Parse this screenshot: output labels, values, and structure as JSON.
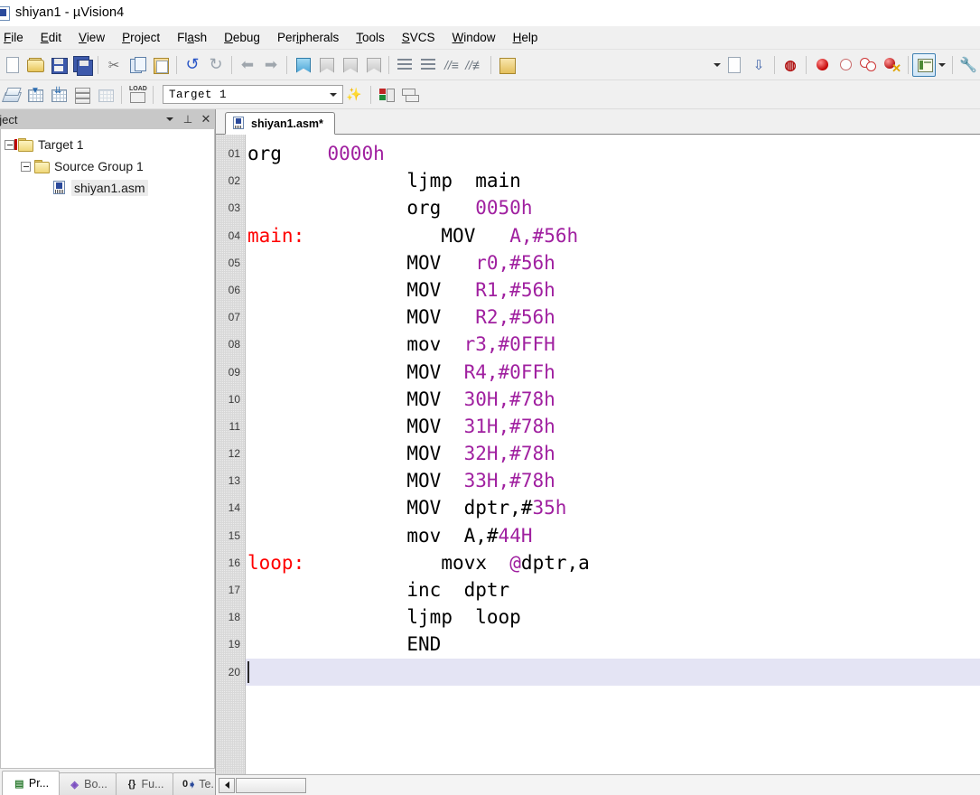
{
  "window": {
    "title": "shiyan1  - µVision4",
    "app_icon": "uvision-icon"
  },
  "menubar": {
    "items": [
      {
        "label": "File",
        "accel": "F"
      },
      {
        "label": "Edit",
        "accel": "E"
      },
      {
        "label": "View",
        "accel": "V"
      },
      {
        "label": "Project",
        "accel": "P"
      },
      {
        "label": "Flash",
        "accel": "a"
      },
      {
        "label": "Debug",
        "accel": "D"
      },
      {
        "label": "Peripherals",
        "accel": "i"
      },
      {
        "label": "Tools",
        "accel": "T"
      },
      {
        "label": "SVCS",
        "accel": "S"
      },
      {
        "label": "Window",
        "accel": "W"
      },
      {
        "label": "Help",
        "accel": "H"
      }
    ]
  },
  "toolbar_main": {
    "buttons": [
      {
        "name": "new-file-icon",
        "tooltip": "New"
      },
      {
        "name": "open-file-icon",
        "tooltip": "Open"
      },
      {
        "name": "save-icon",
        "tooltip": "Save"
      },
      {
        "name": "save-all-icon",
        "tooltip": "Save All"
      },
      {
        "name": "cut-icon",
        "tooltip": "Cut"
      },
      {
        "name": "copy-icon",
        "tooltip": "Copy"
      },
      {
        "name": "paste-icon",
        "tooltip": "Paste"
      },
      {
        "name": "undo-icon",
        "tooltip": "Undo"
      },
      {
        "name": "redo-icon",
        "tooltip": "Redo"
      },
      {
        "name": "navigate-back-icon",
        "tooltip": "Back"
      },
      {
        "name": "navigate-forward-icon",
        "tooltip": "Forward"
      },
      {
        "name": "toggle-bookmark-icon",
        "tooltip": "Insert/Remove Bookmark"
      },
      {
        "name": "prev-bookmark-icon",
        "tooltip": "Previous Bookmark"
      },
      {
        "name": "next-bookmark-icon",
        "tooltip": "Next Bookmark"
      },
      {
        "name": "clear-bookmarks-icon",
        "tooltip": "Clear All Bookmarks"
      },
      {
        "name": "indent-icon",
        "tooltip": "Indent Selection"
      },
      {
        "name": "outdent-icon",
        "tooltip": "Outdent Selection"
      },
      {
        "name": "comment-icon",
        "tooltip": "Comment Selection"
      },
      {
        "name": "uncomment-icon",
        "tooltip": "Uncomment Selection"
      },
      {
        "name": "find-in-files-icon",
        "tooltip": "Find in Files"
      },
      {
        "name": "find-combo-arrow-icon",
        "tooltip": "Find"
      },
      {
        "name": "goto-definition-icon",
        "tooltip": "Go To Definition"
      },
      {
        "name": "find-next-icon",
        "tooltip": "Find Next"
      },
      {
        "name": "debug-search-icon",
        "tooltip": "Find"
      },
      {
        "name": "insert-breakpoint-icon",
        "tooltip": "Insert/Remove Breakpoint"
      },
      {
        "name": "disable-breakpoint-icon",
        "tooltip": "Enable/Disable Breakpoint"
      },
      {
        "name": "disable-all-breakpoints-icon",
        "tooltip": "Disable All Breakpoints"
      },
      {
        "name": "kill-all-breakpoints-icon",
        "tooltip": "Kill All Breakpoints"
      },
      {
        "name": "project-window-icon",
        "tooltip": "Project Window",
        "active": true
      },
      {
        "name": "project-window-dropdown-icon",
        "tooltip": "More Windows"
      },
      {
        "name": "configure-icon",
        "tooltip": "Configuration Wizard"
      }
    ]
  },
  "toolbar_build": {
    "buttons": [
      {
        "name": "translate-icon",
        "tooltip": "Translate"
      },
      {
        "name": "build-target-icon",
        "tooltip": "Build Target"
      },
      {
        "name": "rebuild-all-icon",
        "tooltip": "Rebuild All Target Files"
      },
      {
        "name": "batch-build-icon",
        "tooltip": "Batch Build"
      },
      {
        "name": "stop-build-icon",
        "tooltip": "Stop Build"
      },
      {
        "name": "download-icon",
        "tooltip": "Download to Flash"
      },
      {
        "name": "target-options-icon",
        "tooltip": "Options for Target"
      },
      {
        "name": "manage-components-icon",
        "tooltip": "Manage Components"
      },
      {
        "name": "multi-project-icon",
        "tooltip": "Manage Multi-Project"
      }
    ],
    "target_select": {
      "value": "Target 1",
      "options": [
        "Target 1"
      ]
    }
  },
  "project_panel": {
    "title": "oject",
    "controls": [
      {
        "name": "panel-menu-icon",
        "glyph": "▼"
      },
      {
        "name": "panel-pin-icon",
        "glyph": "⊥"
      },
      {
        "name": "panel-close-icon",
        "glyph": "✕"
      }
    ],
    "tree": [
      {
        "label": "Target 1",
        "level": 1,
        "icon": "target-folder-icon",
        "expanded": true,
        "selected": false
      },
      {
        "label": "Source Group 1",
        "level": 2,
        "icon": "folder-icon",
        "expanded": true,
        "selected": false
      },
      {
        "label": "shiyan1.asm",
        "level": 3,
        "icon": "asm-file-icon",
        "expanded": false,
        "selected": true
      }
    ],
    "tabs": [
      {
        "label": "Pr...",
        "icon": "project-tab-icon",
        "active": true
      },
      {
        "label": "Bo...",
        "icon": "books-tab-icon",
        "active": false
      },
      {
        "label": "Fu...",
        "icon": "functions-tab-icon",
        "active": false
      },
      {
        "label": "Te...",
        "icon": "templates-tab-icon",
        "active": false
      }
    ]
  },
  "editor": {
    "tabs": [
      {
        "label": "shiyan1.asm*",
        "icon": "asm-file-icon",
        "active": true,
        "modified": true
      }
    ],
    "current_line": 20,
    "scrollbar": {
      "name": "horizontal-scrollbar",
      "position": "left"
    },
    "lines": [
      {
        "num": "01",
        "tokens": [
          {
            "t": "org    ",
            "c": "plain"
          },
          {
            "t": "0000h",
            "c": "num"
          }
        ],
        "indent": 0
      },
      {
        "num": "02",
        "tokens": [
          {
            "t": "ljmp  main",
            "c": "plain"
          }
        ],
        "indent": 14
      },
      {
        "num": "03",
        "tokens": [
          {
            "t": "org   ",
            "c": "plain"
          },
          {
            "t": "0050h",
            "c": "num"
          }
        ],
        "indent": 14
      },
      {
        "num": "04",
        "tokens": [
          {
            "t": "main:",
            "c": "label"
          }
        ],
        "indent": 0,
        "extra": {
          "indent": 14,
          "tokens": [
            {
              "t": "MOV   ",
              "c": "plain"
            },
            {
              "t": "A,#56h",
              "c": "num"
            }
          ]
        }
      },
      {
        "num": "05",
        "tokens": [
          {
            "t": "MOV   ",
            "c": "plain"
          },
          {
            "t": "r0,#56h",
            "c": "num"
          }
        ],
        "indent": 14
      },
      {
        "num": "06",
        "tokens": [
          {
            "t": "MOV   ",
            "c": "plain"
          },
          {
            "t": "R1,#56h",
            "c": "num"
          }
        ],
        "indent": 14
      },
      {
        "num": "07",
        "tokens": [
          {
            "t": "MOV   ",
            "c": "plain"
          },
          {
            "t": "R2,#56h",
            "c": "num"
          }
        ],
        "indent": 14
      },
      {
        "num": "08",
        "tokens": [
          {
            "t": "mov  ",
            "c": "plain"
          },
          {
            "t": "r3,#0FFH",
            "c": "num"
          }
        ],
        "indent": 14
      },
      {
        "num": "09",
        "tokens": [
          {
            "t": "MOV  ",
            "c": "plain"
          },
          {
            "t": "R4,#0FFh",
            "c": "num"
          }
        ],
        "indent": 14
      },
      {
        "num": "10",
        "tokens": [
          {
            "t": "MOV  ",
            "c": "plain"
          },
          {
            "t": "30H,#78h",
            "c": "num"
          }
        ],
        "indent": 14
      },
      {
        "num": "11",
        "tokens": [
          {
            "t": "MOV  ",
            "c": "plain"
          },
          {
            "t": "31H,#78h",
            "c": "num"
          }
        ],
        "indent": 14
      },
      {
        "num": "12",
        "tokens": [
          {
            "t": "MOV  ",
            "c": "plain"
          },
          {
            "t": "32H,#78h",
            "c": "num"
          }
        ],
        "indent": 14
      },
      {
        "num": "13",
        "tokens": [
          {
            "t": "MOV  ",
            "c": "plain"
          },
          {
            "t": "33H,#78h",
            "c": "num"
          }
        ],
        "indent": 14
      },
      {
        "num": "14",
        "tokens": [
          {
            "t": "MOV  dptr,#",
            "c": "plain"
          },
          {
            "t": "35h",
            "c": "num"
          }
        ],
        "indent": 14
      },
      {
        "num": "15",
        "tokens": [
          {
            "t": "mov  A,#",
            "c": "plain"
          },
          {
            "t": "44H",
            "c": "num"
          }
        ],
        "indent": 14
      },
      {
        "num": "16",
        "tokens": [
          {
            "t": "loop:",
            "c": "label"
          }
        ],
        "indent": 0,
        "extra": {
          "indent": 14,
          "tokens": [
            {
              "t": "movx  ",
              "c": "plain"
            },
            {
              "t": "@",
              "c": "num"
            },
            {
              "t": "dptr,a",
              "c": "plain"
            }
          ]
        }
      },
      {
        "num": "17",
        "tokens": [
          {
            "t": "inc  dptr",
            "c": "plain"
          }
        ],
        "indent": 14
      },
      {
        "num": "18",
        "tokens": [
          {
            "t": "ljmp  loop",
            "c": "plain"
          }
        ],
        "indent": 14
      },
      {
        "num": "19",
        "tokens": [
          {
            "t": "END",
            "c": "plain"
          }
        ],
        "indent": 14
      },
      {
        "num": "20",
        "tokens": [],
        "indent": 0
      }
    ]
  },
  "colors": {
    "label": "#ff0000",
    "number": "#a020a0",
    "plain": "#000000",
    "current_line_bg": "#e4e4f4",
    "gutter_bg": "#ececec",
    "editor_bg": "#ffffff",
    "chrome_bg": "#f0f0f0",
    "panel_title_bg": "#c8c8c8"
  }
}
